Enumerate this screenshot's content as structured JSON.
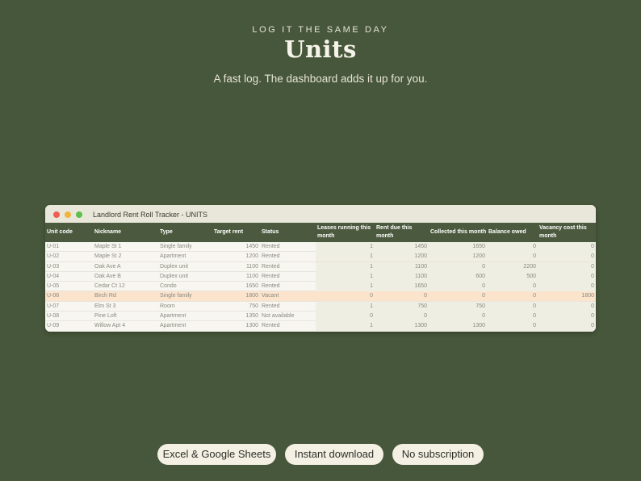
{
  "hero": {
    "eyebrow": "LOG IT THE SAME DAY",
    "title": "Units",
    "subtitle": "A fast log. The dashboard adds it up for you."
  },
  "window": {
    "title": "Landlord Rent Roll Tracker  -  UNITS"
  },
  "table": {
    "headers": [
      "Unit code",
      "Nickname",
      "Type",
      "Target rent",
      "Status",
      "Leases running this month",
      "Rent due this month",
      "Collected this month",
      "Balance owed",
      "Vacancy cost this month"
    ],
    "rows": [
      [
        "U-01",
        "Maple St 1",
        "Single family",
        "1450",
        "Rented",
        "1",
        "1450",
        "1650",
        "0",
        "0"
      ],
      [
        "U-02",
        "Maple St 2",
        "Apartment",
        "1200",
        "Rented",
        "1",
        "1200",
        "1200",
        "0",
        "0"
      ],
      [
        "U-03",
        "Oak Ave A",
        "Duplex unit",
        "1100",
        "Rented",
        "1",
        "1100",
        "0",
        "2200",
        "0"
      ],
      [
        "U-04",
        "Oak Ave B",
        "Duplex unit",
        "1100",
        "Rented",
        "1",
        "1100",
        "600",
        "500",
        "0"
      ],
      [
        "U-05",
        "Cedar Ct 12",
        "Condo",
        "1650",
        "Rented",
        "1",
        "1650",
        "0",
        "0",
        "0"
      ],
      [
        "U-06",
        "Birch Rd",
        "Single family",
        "1800",
        "Vacant",
        "0",
        "0",
        "0",
        "0",
        "1800"
      ],
      [
        "U-07",
        "Elm St 3",
        "Room",
        "750",
        "Rented",
        "1",
        "750",
        "750",
        "0",
        "0"
      ],
      [
        "U-08",
        "Pine Loft",
        "Apartment",
        "1350",
        "Not available",
        "0",
        "0",
        "0",
        "0",
        "0"
      ],
      [
        "U-09",
        "Willow Apt 4",
        "Apartment",
        "1300",
        "Rented",
        "1",
        "1300",
        "1300",
        "0",
        "0"
      ]
    ]
  },
  "badges": [
    "Excel & Google Sheets",
    "Instant download",
    "No subscription"
  ],
  "colors": {
    "background": "#47573b",
    "header": "#4b5a3e",
    "vacant_row": "#fbe3cc",
    "calc_band": "#efeee3"
  }
}
